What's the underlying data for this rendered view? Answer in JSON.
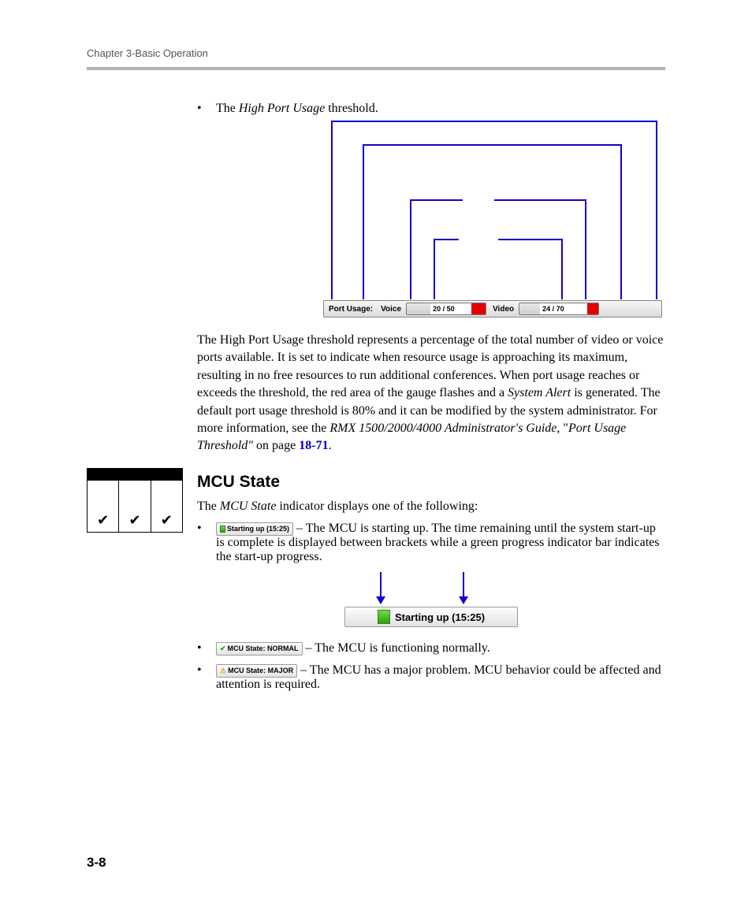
{
  "header": {
    "running": "Chapter 3-Basic Operation"
  },
  "bullet1": {
    "pre": "The ",
    "em": "High Port Usage",
    "post": " threshold."
  },
  "portbar": {
    "label": "Port Usage:",
    "voice_label": "Voice",
    "voice_value": "20 / 50",
    "video_label": "Video",
    "video_value": "24 / 70"
  },
  "para1": {
    "t1": "The High Port Usage threshold represents a percentage of the total number of video or voice ports available. It is set to indicate when resource usage is approaching its maximum, resulting in no free resources to run additional conferences. When port usage reaches or exceeds the threshold, the red area of the gauge flashes and a ",
    "em1": "System Alert",
    "t2": " is generated. The default port usage threshold is 80% and it can be modified by the system administrator. For more information, see the ",
    "em2": "RMX 1500/2000/4000 Administrator's Guide",
    "t3": ", \"",
    "em3": "Port Usage Threshold\"",
    "t4": " on page ",
    "link": "18-71",
    "t5": "."
  },
  "mcu": {
    "heading": "MCU State",
    "intro_pre": "The ",
    "intro_em": "MCU State",
    "intro_post": " indicator displays one of the following:",
    "item1_chip": "Starting up (15:25)",
    "item1_text": " – The MCU is starting up. The time remaining until the system start-up is complete is displayed between brackets while a green progress indicator bar indicates the start-up progress.",
    "callout_text": "Starting up (15:25)",
    "item2_chip": "MCU State: NORMAL",
    "item2_text": " – The MCU is functioning normally.",
    "item3_chip": "MCU State: MAJOR",
    "item3_text": " – The MCU has a major problem. MCU behavior could be affected and attention is required."
  },
  "footer": {
    "pagenum": "3-8"
  }
}
